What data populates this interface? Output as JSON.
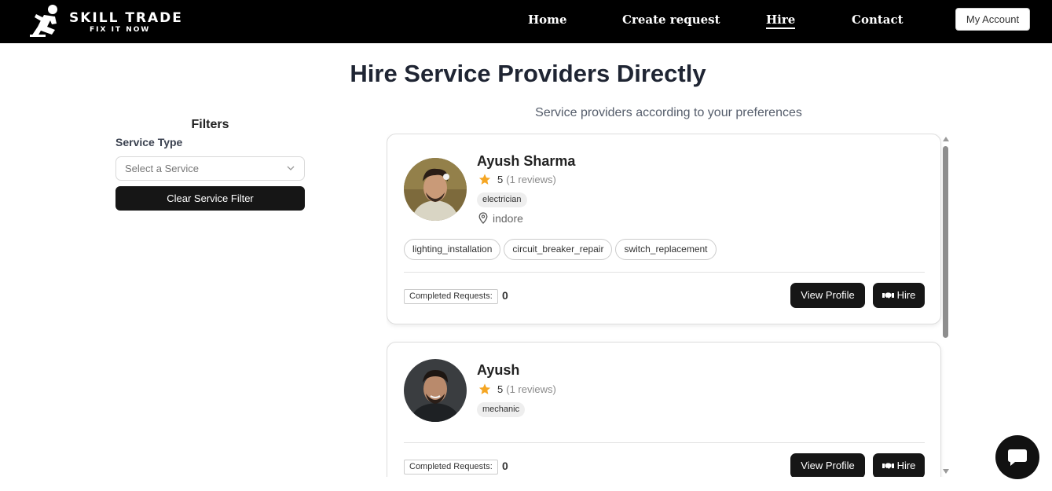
{
  "header": {
    "logo_title": "SKILL TRADE",
    "logo_subtitle": "FIX IT NOW",
    "nav": [
      {
        "label": "Home"
      },
      {
        "label": "Create request"
      },
      {
        "label": "Hire",
        "active": true
      },
      {
        "label": "Contact"
      }
    ],
    "account_label": "My Account"
  },
  "page_title": "Hire Service Providers Directly",
  "filters": {
    "title": "Filters",
    "service_type_label": "Service Type",
    "select_placeholder": "Select a Service",
    "clear_label": "Clear Service Filter"
  },
  "results": {
    "subtitle": "Service providers according to your preferences",
    "completed_label": "Completed Requests:",
    "view_profile_label": "View Profile",
    "hire_label": "Hire",
    "providers": [
      {
        "name": "Ayush Sharma",
        "rating": "5",
        "reviews": "(1 reviews)",
        "category": "electrician",
        "location": "indore",
        "skills": [
          "lighting_installation",
          "circuit_breaker_repair",
          "switch_replacement"
        ],
        "completed": "0"
      },
      {
        "name": "Ayush",
        "rating": "5",
        "reviews": "(1 reviews)",
        "category": "mechanic",
        "completed": "0"
      }
    ]
  },
  "colors": {
    "header_bg": "#000000",
    "button_dark": "#161616",
    "star": "#f5a623",
    "title": "#1f2533"
  },
  "icons": [
    "logo-figure-icon",
    "chevron-down-icon",
    "star-icon",
    "location-pin-icon",
    "handshake-icon",
    "chat-icon"
  ]
}
